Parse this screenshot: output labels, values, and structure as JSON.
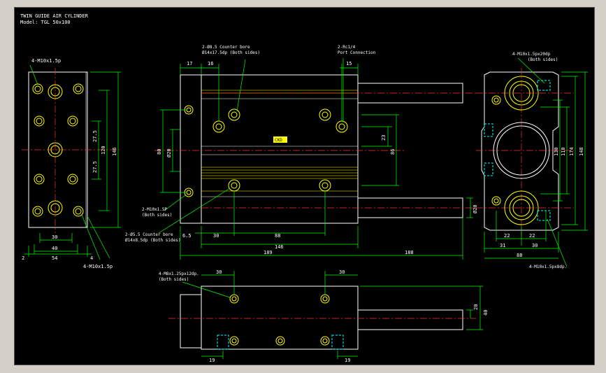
{
  "title_block": {
    "line1": "TWIN GUIDE AIR CYLINDER",
    "line2": "Model: TGL 50x100"
  },
  "colors": {
    "background": "#000000",
    "outline": "#ffffff",
    "centerline": "#ff3030",
    "dimension": "#00ff00",
    "text": "#ffffff",
    "highlight": "#ffff00",
    "hidden": "#00ffff",
    "frame": "#d4d0c8"
  },
  "left_view": {
    "top_note": "4-M10x1.5p",
    "bottom_note": "4-M10x1.5p",
    "dims": {
      "v1": "27.5",
      "v2": "120",
      "v3": "146",
      "v4": "27.5",
      "h1": "30",
      "h2": "40",
      "h3": "54",
      "h4": "2",
      "h5": "4"
    }
  },
  "front_view": {
    "note_top_left_1": "2-Ø8.5 Counter bore",
    "note_top_left_2": "Ø14x17.5dp (Both sides)",
    "note_top_right_1": "2-Rc1/4",
    "note_top_right_2": "Port Connection",
    "note_left_1": "2-M10x1.5P",
    "note_left_2": "(Both sides)",
    "note_bottom_1": "2-Ø5.5 Counter bore",
    "note_bottom_2": "Ø14x8.5dp (Both sides)",
    "dims": {
      "d17": "17",
      "d16": "16",
      "d15": "15",
      "d23": "23",
      "d86": "86",
      "d80": "80",
      "d60": "Ø20",
      "d30": "30",
      "d88": "88",
      "d146": "146",
      "d65": "6.5",
      "d189": "189",
      "d188": "188",
      "d020": "Ø20"
    },
    "label_plate": "CKD"
  },
  "right_view": {
    "note_top_1": "4-M10x1.5px20dp",
    "note_top_2": "(Both sides)",
    "note_bottom": "4-M10x1.5px8dp.",
    "dims": {
      "d130": "130",
      "d110": "110",
      "d174": "174",
      "d148": "148",
      "d22a": "22",
      "d22b": "22",
      "d31": "31",
      "d30": "30",
      "d88": "88"
    }
  },
  "bottom_view": {
    "note_1": "4-M8x1.25px12dp.",
    "note_2": "(Both sides)",
    "dims": {
      "d30a": "30",
      "d30b": "30",
      "d20": "20",
      "d40": "40",
      "d19a": "19",
      "d19b": "19"
    }
  }
}
